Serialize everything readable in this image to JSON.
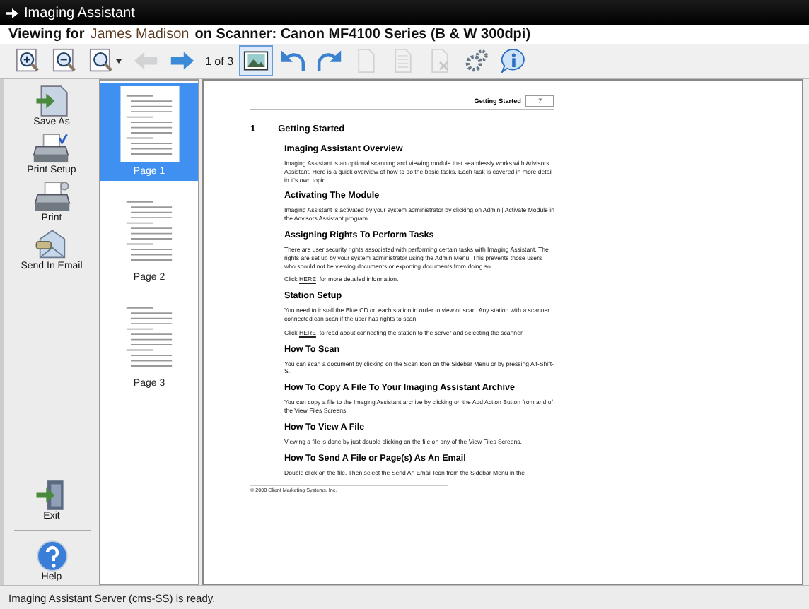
{
  "window": {
    "title": "Imaging Assistant"
  },
  "header": {
    "label": "Viewing for",
    "user": "James Madison",
    "scanner": "on Scanner: Canon MF4100 Series (B & W 300dpi)"
  },
  "toolbar": [
    {
      "kind": "zoom-in",
      "disabled": false,
      "pressed": false
    },
    {
      "kind": "zoom-out",
      "disabled": false,
      "pressed": false
    },
    {
      "kind": "zoom-menu",
      "disabled": false,
      "pressed": false
    },
    {
      "kind": "back",
      "disabled": true,
      "pressed": false
    },
    {
      "kind": "forward",
      "disabled": false,
      "pressed": false
    },
    {
      "kind": "counter",
      "text": "1 of 3"
    },
    {
      "kind": "image",
      "disabled": false,
      "pressed": true
    },
    {
      "kind": "rotate-left",
      "disabled": false,
      "pressed": false
    },
    {
      "kind": "rotate-right",
      "disabled": false,
      "pressed": false
    },
    {
      "kind": "page",
      "disabled": true,
      "pressed": false
    },
    {
      "kind": "pages",
      "disabled": true,
      "pressed": false
    },
    {
      "kind": "delete-page",
      "disabled": true,
      "pressed": false
    },
    {
      "kind": "settings",
      "disabled": false,
      "pressed": false
    },
    {
      "kind": "info",
      "disabled": false,
      "pressed": false
    }
  ],
  "sidebar": {
    "top": [
      {
        "kind": "save",
        "label": "Save As"
      },
      {
        "kind": "print-setup",
        "label": "Print Setup"
      },
      {
        "kind": "print",
        "label": "Print"
      },
      {
        "kind": "email",
        "label": "Send In Email"
      }
    ],
    "bottom": [
      {
        "kind": "exit",
        "label": "Exit"
      },
      {
        "kind": "help",
        "label": "Help"
      }
    ]
  },
  "thumbnails": [
    {
      "label": "Page 1",
      "selected": true
    },
    {
      "label": "Page 2",
      "selected": false
    },
    {
      "label": "Page 3",
      "selected": false
    }
  ],
  "document": {
    "running_head": "Getting Started",
    "page_number": "7",
    "chapter_number": "1",
    "chapter_title": "Getting Started",
    "sections": [
      {
        "heading": "Imaging Assistant Overview",
        "paragraphs": [
          {
            "text": "Imaging Assistant is an optional scanning and viewing module that seamlessly works with Advisors Assistant.  Here is a quick overview of how to do the basic tasks.  Each task is covered in more detail in it's own topic."
          }
        ]
      },
      {
        "heading": "Activating The Module",
        "paragraphs": [
          {
            "text": "Imaging Assistant is activated by your system administrator by clicking on Admin | Activate Module in the Advisors Assistant program."
          }
        ]
      },
      {
        "heading": "Assigning Rights To Perform Tasks",
        "paragraphs": [
          {
            "text": "There are user security rights associated with performing certain tasks with Imaging Assistant.  The rights are set up by your system administrator using the Admin Menu. This prevents those users who should not be viewing documents or exporting documents from doing so."
          },
          {
            "text": "Click",
            "link": "HERE",
            "after": "for more detailed information."
          }
        ]
      },
      {
        "heading": "Station Setup",
        "paragraphs": [
          {
            "text": "You need to install the Blue CD on each station in order to view or scan.  Any station with a scanner connected can scan if the user has rights to scan."
          },
          {
            "text": "Click",
            "link": "HERE",
            "after": "to read about connecting the station to the server and selecting the scanner."
          }
        ]
      },
      {
        "heading": "How To Scan",
        "paragraphs": [
          {
            "text": "You can scan a document by clicking on the Scan Icon on the Sidebar Menu or by pressing Alt-Shift-S."
          }
        ]
      },
      {
        "heading": "How To Copy A File To Your Imaging Assistant Archive",
        "paragraphs": [
          {
            "text": "You can copy a file to the Imaging Assistant archive by clicking on the Add Action Button from and of the View Files Screens."
          }
        ]
      },
      {
        "heading": "How To View A File",
        "paragraphs": [
          {
            "text": "Viewing a file is done by just double clicking on the file on any of the View Files Screens."
          }
        ]
      },
      {
        "heading": "How To Send A File or Page(s) As An Email",
        "paragraphs": [
          {
            "text": "Double click on the file.  Then select the Send An Email Icon from the Sidebar Menu in the"
          }
        ]
      }
    ],
    "footer": "© 2008 Client Marketing Systems, Inc."
  },
  "status_bar": "Imaging Assistant Server (cms-SS) is ready."
}
